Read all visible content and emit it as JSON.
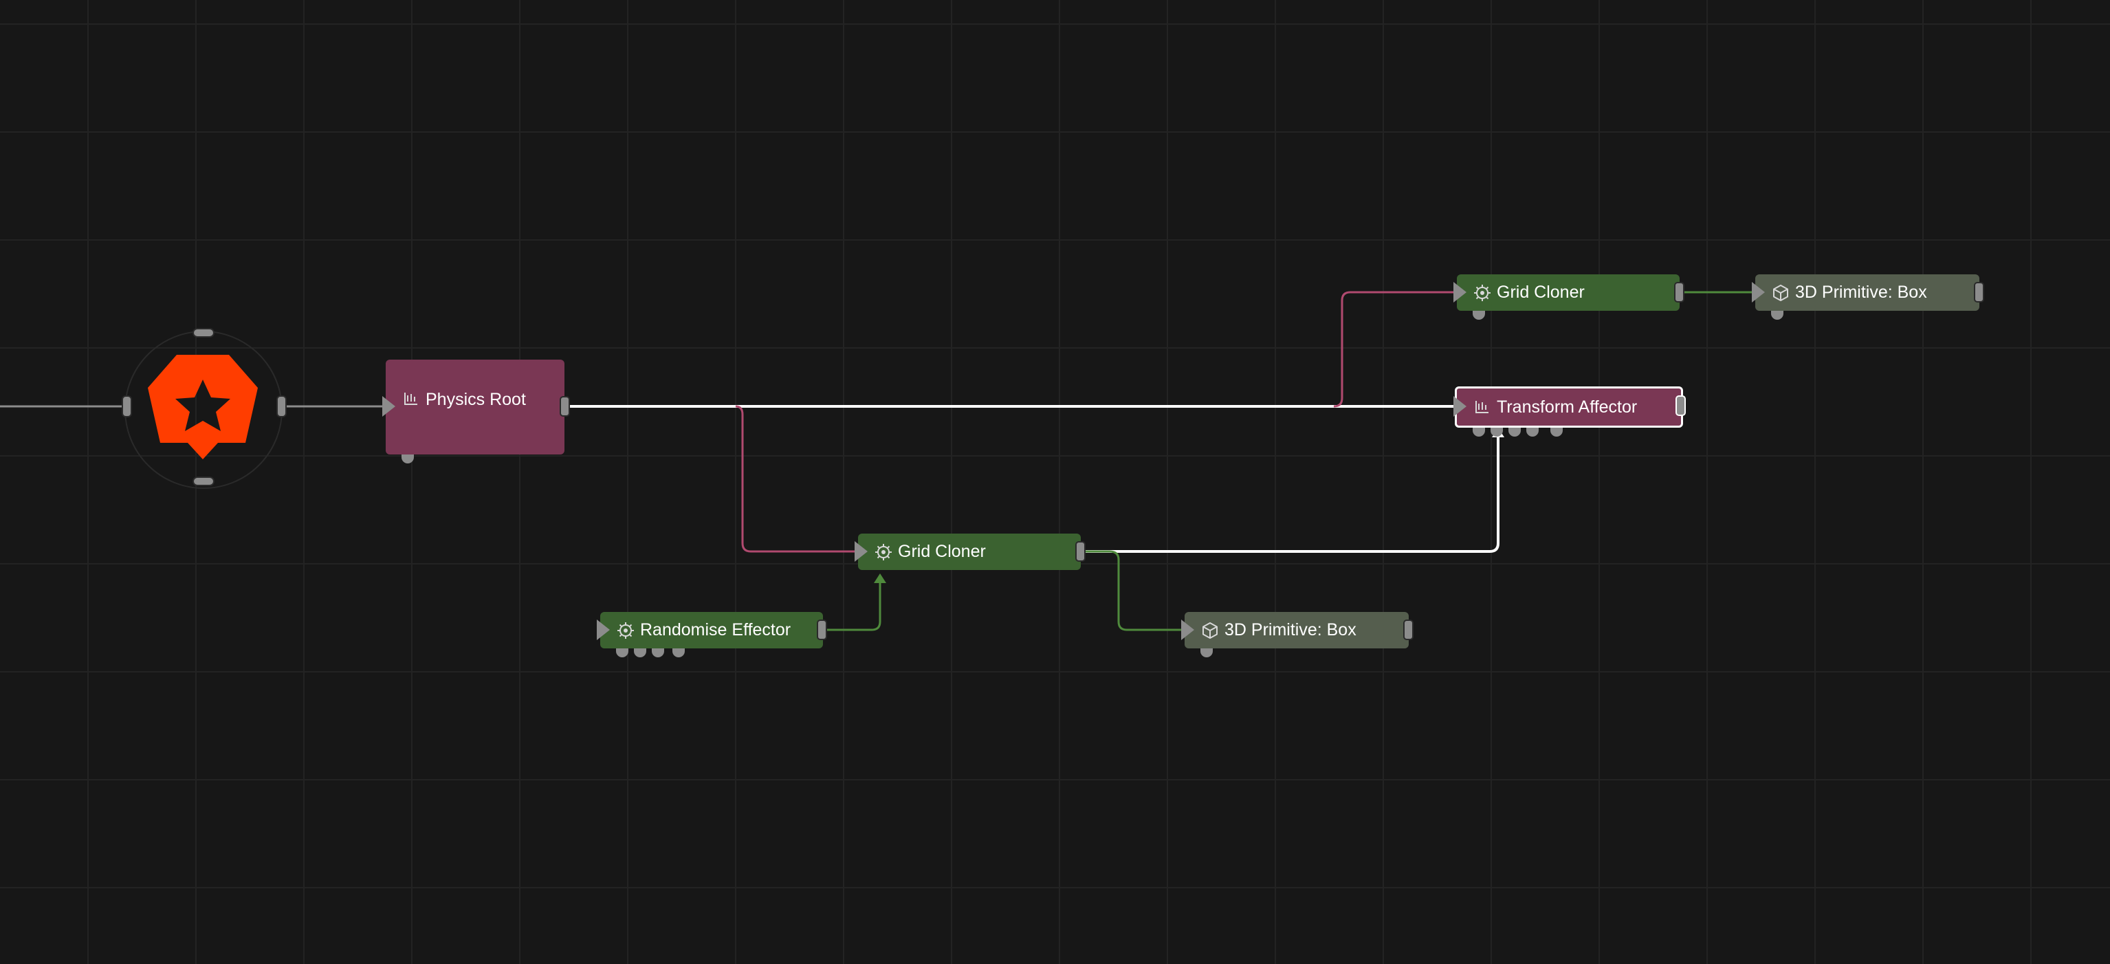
{
  "canvas": {
    "background": "#171717",
    "grid_color": "#232323",
    "wire_colors": {
      "main": "#ffffff",
      "physics": "#b04a6f",
      "cloner": "#4f8a3c",
      "root": "#8c8c8c"
    }
  },
  "root_node": {
    "icon": "logo-star-gear-icon",
    "color": "#ff3d00"
  },
  "nodes": {
    "physics_root": {
      "label": "Physics Root",
      "icon": "physics-icon",
      "color": "#7a3754"
    },
    "grid_cloner_top": {
      "label": "Grid Cloner",
      "icon": "cloner-gear-icon",
      "color": "#3b6230"
    },
    "box_top": {
      "label": "3D Primitive: Box",
      "icon": "cube-icon",
      "color": "#555e4e"
    },
    "transform_affector": {
      "label": "Transform Affector",
      "icon": "physics-icon",
      "color": "#7a3754",
      "selected": true
    },
    "grid_cloner_mid": {
      "label": "Grid Cloner",
      "icon": "cloner-gear-icon",
      "color": "#3b6230"
    },
    "randomise_effector": {
      "label": "Randomise Effector",
      "icon": "cloner-gear-icon",
      "color": "#3b6230"
    },
    "box_bottom": {
      "label": "3D Primitive: Box",
      "icon": "cube-icon",
      "color": "#555e4e"
    }
  }
}
